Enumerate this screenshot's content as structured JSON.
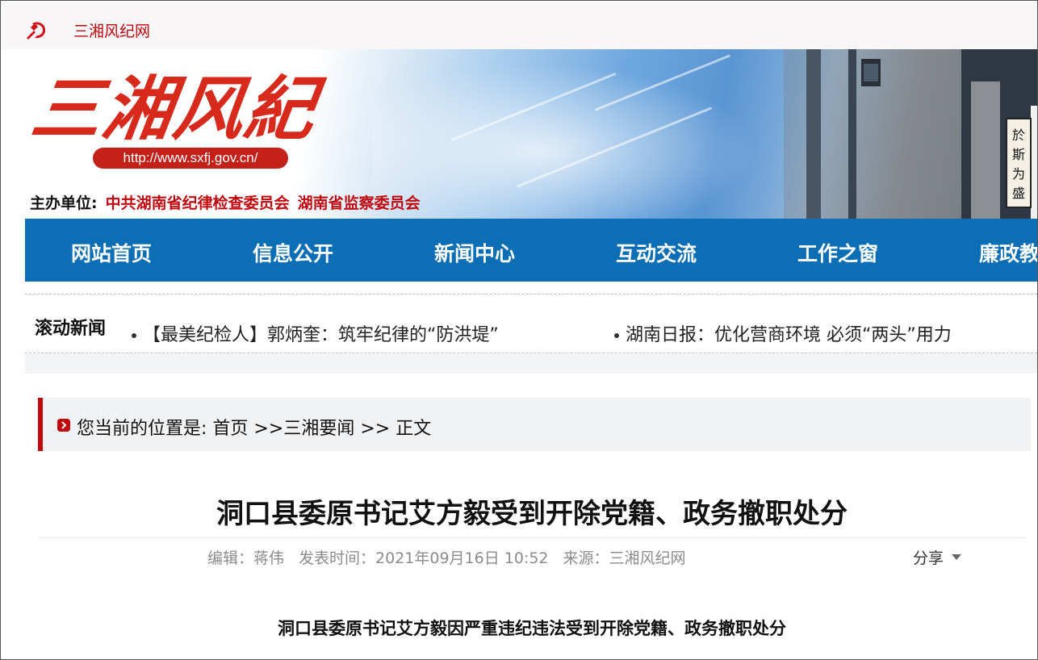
{
  "topbar": {
    "site_name": "三湘风纪网"
  },
  "banner": {
    "logo_text": "三湘风紀",
    "url": "http://www.sxfj.gov.cn/",
    "sponsor_label": "主办单位:",
    "sponsor_org1": "中共湖南省纪律检查委员会",
    "sponsor_org2": "湖南省监察委员会"
  },
  "nav": {
    "items": [
      {
        "label": "网站首页"
      },
      {
        "label": "信息公开"
      },
      {
        "label": "新闻中心"
      },
      {
        "label": "互动交流"
      },
      {
        "label": "工作之窗"
      },
      {
        "label": "廉政教"
      }
    ]
  },
  "ticker": {
    "label": "滚动新闻",
    "items": [
      {
        "text": "【最美纪检人】郭炳奎：筑牢纪律的“防洪堤”"
      },
      {
        "text": "湖南日报：优化营商环境 必须“两头”用力"
      }
    ]
  },
  "breadcrumb": {
    "prefix": "您当前的位置是:",
    "home": "首页",
    "sep1": " >>",
    "section": "三湘要闻",
    "sep2": " >> ",
    "current": "正文"
  },
  "article": {
    "title": "洞口县委原书记艾方毅受到开除党籍、政务撤职处分",
    "editor": "编辑：蒋伟",
    "published": "发表时间：2021年09月16日 10:52",
    "source": "来源：三湘风纪网",
    "share_label": "分享",
    "subheading": "洞口县委原书记艾方毅因严重违纪违法受到开除党籍、政务撤职处分"
  },
  "colors": {
    "brand_red": "#c0080f",
    "nav_blue": "#0c6eb5"
  }
}
